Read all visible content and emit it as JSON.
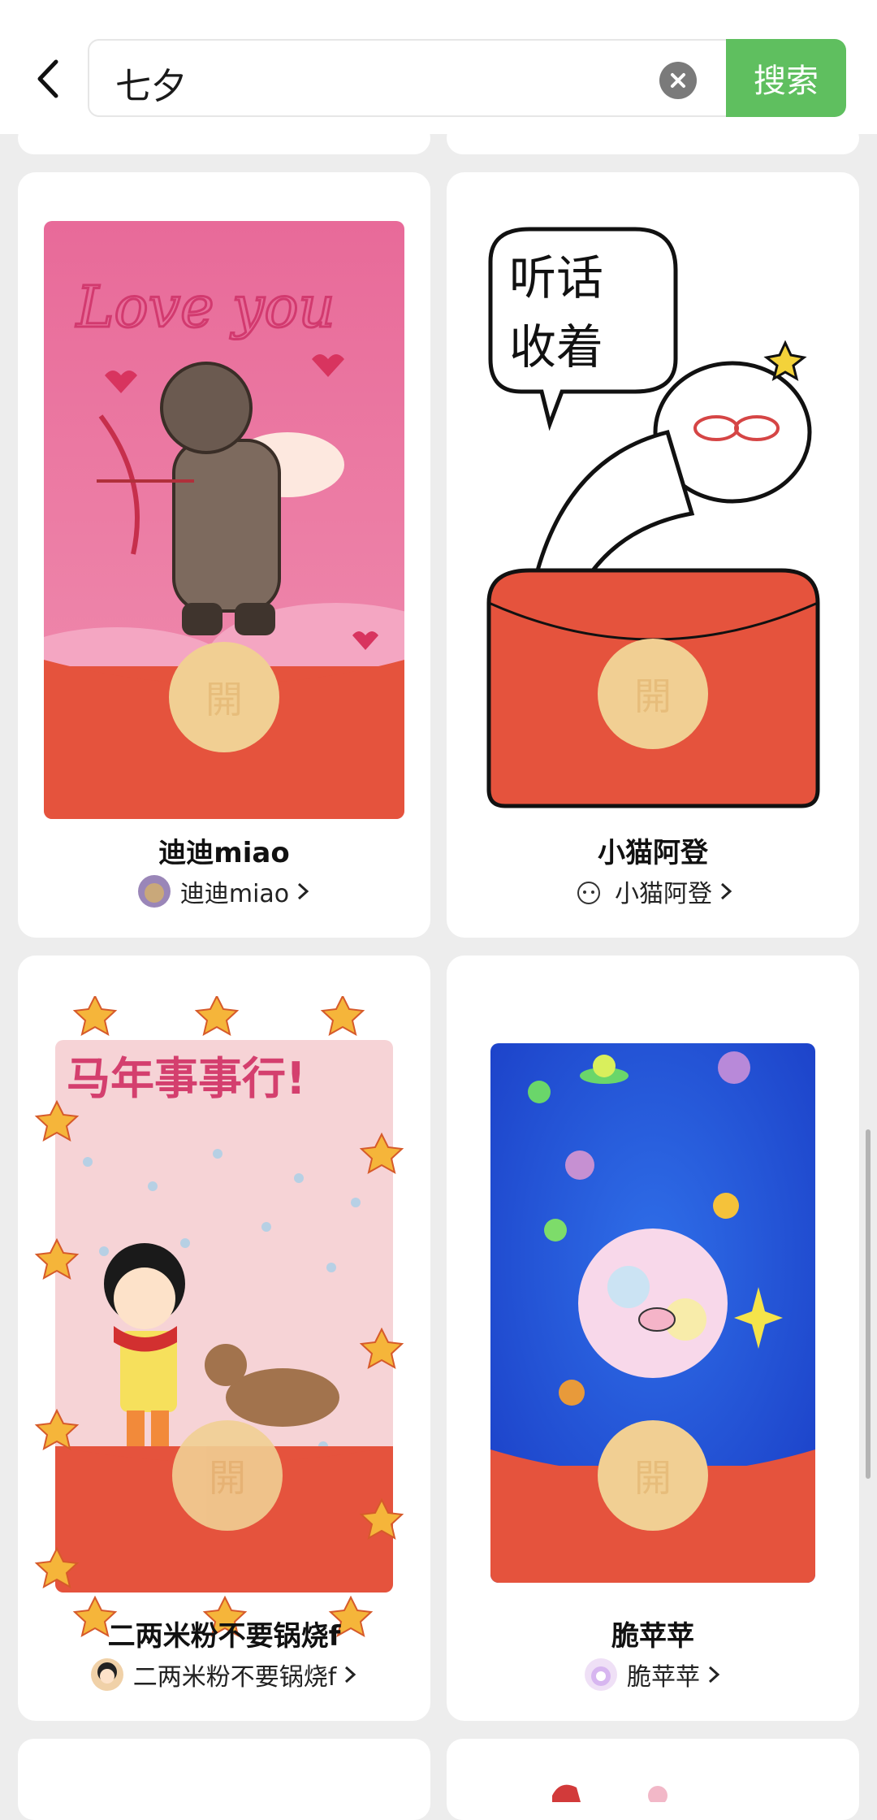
{
  "search": {
    "query": "七夕",
    "button_label": "搜索"
  },
  "cards": [
    {
      "title": "迪迪miao",
      "author": "迪迪miao",
      "open_label": "開",
      "art_text": "Love you"
    },
    {
      "title": "小猫阿登",
      "author": "小猫阿登",
      "open_label": "開",
      "art_text_line1": "听话",
      "art_text_line2": "收着"
    },
    {
      "title": "二两米粉不要锅烧f",
      "author": "二两米粉不要锅烧f",
      "open_label": "開",
      "art_text": "马年事事行!"
    },
    {
      "title": "脆苹苹",
      "author": "脆苹苹",
      "open_label": "開"
    }
  ],
  "colors": {
    "accent_green": "#5fbf5f",
    "envelope_red": "#e5533d",
    "coin_gold": "#f1cf93"
  }
}
